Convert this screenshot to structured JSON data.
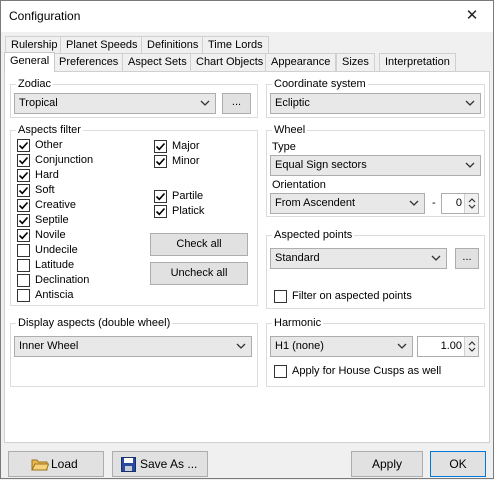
{
  "window": {
    "title": "Configuration"
  },
  "tabs_row1": [
    "Rulership",
    "Planet Speeds",
    "Definitions",
    "Time Lords"
  ],
  "tabs_row2": [
    "General",
    "Preferences",
    "Aspect Sets",
    "Chart Objects",
    "Appearance",
    "Sizes",
    "Interpretation"
  ],
  "active_tab": "General",
  "zodiac": {
    "legend": "Zodiac",
    "value": "Tropical",
    "more_label": "..."
  },
  "aspects_filter": {
    "legend": "Aspects filter",
    "left_items": [
      {
        "label": "Other",
        "checked": true
      },
      {
        "label": "Conjunction",
        "checked": true
      },
      {
        "label": "Hard",
        "checked": true
      },
      {
        "label": "Soft",
        "checked": true
      },
      {
        "label": "Creative",
        "checked": true
      },
      {
        "label": "Septile",
        "checked": true
      },
      {
        "label": "Novile",
        "checked": true
      },
      {
        "label": "Undecile",
        "checked": false
      },
      {
        "label": "Latitude",
        "checked": false
      },
      {
        "label": "Declination",
        "checked": false
      },
      {
        "label": "Antiscia",
        "checked": false
      }
    ],
    "right_items": [
      {
        "label": "Major",
        "checked": true
      },
      {
        "label": "Minor",
        "checked": true
      },
      {
        "label": "Partile",
        "checked": true
      },
      {
        "label": "Platick",
        "checked": true
      }
    ],
    "check_all_label": "Check all",
    "uncheck_all_label": "Uncheck all"
  },
  "display_aspects": {
    "legend": "Display aspects (double wheel)",
    "value": "Inner Wheel"
  },
  "coordinate_system": {
    "legend": "Coordinate system",
    "value": "Ecliptic"
  },
  "wheel": {
    "legend": "Wheel",
    "type_label": "Type",
    "type_value": "Equal Sign sectors",
    "orientation_label": "Orientation",
    "orientation_value": "From Ascendent",
    "offset_sign": "-",
    "offset_value": "0"
  },
  "aspected_points": {
    "legend": "Aspected points",
    "value": "Standard",
    "more_label": "...",
    "filter_label": "Filter on aspected points",
    "filter_checked": false
  },
  "harmonic": {
    "legend": "Harmonic",
    "value": "H1 (none)",
    "number": "1.00",
    "cusps_label": "Apply for House Cusps as well",
    "cusps_checked": false
  },
  "footer": {
    "load_label": "Load",
    "save_as_label": "Save As ...",
    "apply_label": "Apply",
    "ok_label": "OK"
  },
  "colors": {
    "accent": "#0078d7",
    "folder": "#e8b84a",
    "disk": "#2a4aa0"
  },
  "icons": {
    "close": "close-icon",
    "load": "folder-icon",
    "save": "floppy-disk-icon"
  }
}
